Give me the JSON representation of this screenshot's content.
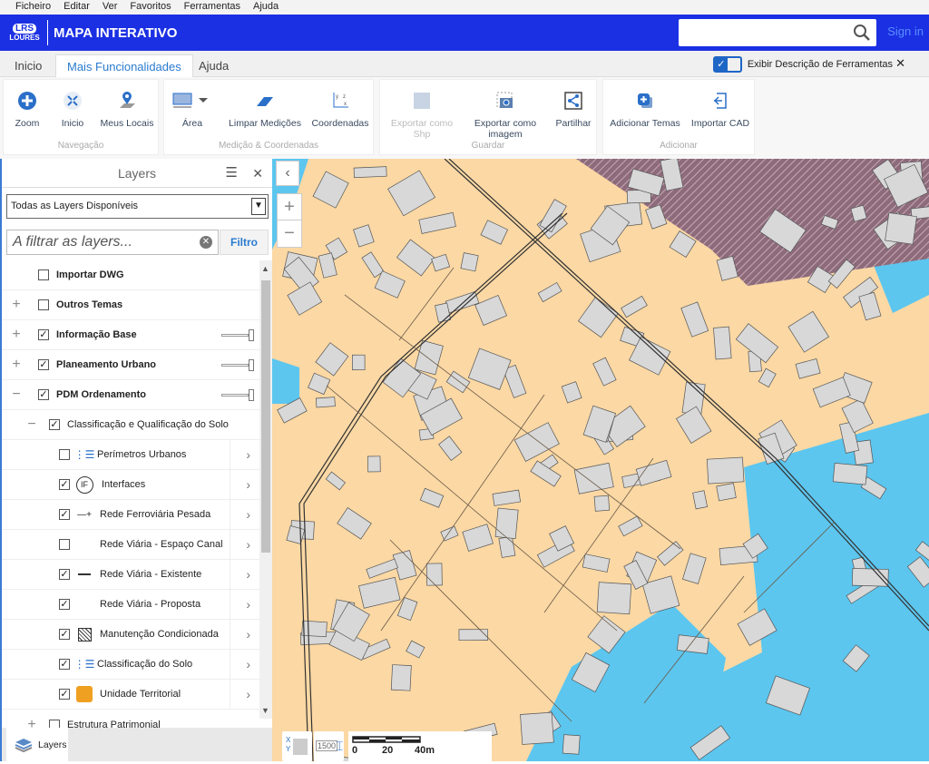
{
  "menu": [
    "Ficheiro",
    "Editar",
    "Ver",
    "Favoritos",
    "Ferramentas",
    "Ajuda"
  ],
  "header": {
    "logo_text": "LRS",
    "logo_sub": "LOURES",
    "title": "MAPA INTERATIVO",
    "search_placeholder": "",
    "signin": "Sign in"
  },
  "tabs": [
    {
      "label": "Inicio"
    },
    {
      "label": "Mais Funcionalidades",
      "active": true
    },
    {
      "label": "Ajuda"
    }
  ],
  "show_descriptions": {
    "label": "Exibir Descrição de Ferramentas",
    "checked": true,
    "close": "✕"
  },
  "ribbon": {
    "groups": [
      {
        "label": "Navegação",
        "buttons": [
          "Zoom",
          "Inicio",
          "Meus Locais"
        ]
      },
      {
        "label": "Medição & Coordenadas",
        "buttons": [
          "Área",
          "Limpar Medições",
          "Coordenadas"
        ]
      },
      {
        "label": "Guardar",
        "buttons": [
          "Exportar como Shp",
          "Exportar como imagem",
          "Partilhar"
        ]
      },
      {
        "label": "Adicionar",
        "buttons": [
          "Adicionar Temas",
          "Importar CAD"
        ]
      }
    ]
  },
  "layers_panel": {
    "title": "Layers",
    "select_value": "Todas as Layers Disponíveis",
    "filter_placeholder": "A filtrar as layers...",
    "filter_button": "Filtro",
    "items": [
      {
        "label": "Importar DWG",
        "checked": false,
        "level": 0
      },
      {
        "label": "Outros Temas",
        "checked": false,
        "level": 0,
        "expander": "+"
      },
      {
        "label": "Informação Base",
        "checked": true,
        "level": 0,
        "expander": "+"
      },
      {
        "label": "Planeamento Urbano",
        "checked": true,
        "level": 0,
        "expander": "+"
      },
      {
        "label": "PDM Ordenamento",
        "checked": true,
        "level": 0,
        "expander": "−"
      },
      {
        "label": "Classificação e Qualificação do Solo",
        "checked": true,
        "level": 1,
        "expander": "−"
      },
      {
        "label": "Perímetros Urbanos",
        "checked": false,
        "level": 2,
        "icon": "legend-list-icon"
      },
      {
        "label": "Interfaces",
        "checked": true,
        "level": 2,
        "icon": "if-circle-icon"
      },
      {
        "label": "Rede Ferroviária Pesada",
        "checked": true,
        "level": 2,
        "icon": "railway-line-icon"
      },
      {
        "label": "Rede Viária - Espaço Canal",
        "checked": false,
        "level": 2,
        "icon": ""
      },
      {
        "label": "Rede Viária - Existente",
        "checked": true,
        "level": 2,
        "icon": "road-line-icon"
      },
      {
        "label": "Rede Viária - Proposta",
        "checked": true,
        "level": 2,
        "icon": ""
      },
      {
        "label": "Manutenção Condicionada",
        "checked": true,
        "level": 2,
        "icon": "hatched-square-icon"
      },
      {
        "label": "Classificação do Solo",
        "checked": true,
        "level": 2,
        "icon": "legend-list-icon"
      },
      {
        "label": "Unidade Territorial",
        "checked": true,
        "level": 2,
        "icon": "orange-patch-icon"
      }
    ],
    "footer_item": {
      "label": "Estrutura Patrimonial",
      "checked": false,
      "expander": "+"
    },
    "bottom_tab": "Layers"
  },
  "map": {
    "zoom_in": "+",
    "zoom_out": "−",
    "collapse": "‹",
    "scale_label": "1500",
    "scale_ticks": [
      "0",
      "20",
      "40m"
    ]
  },
  "colors": {
    "header": "#1b30e3",
    "land": "#fbd8a4",
    "water": "#5cc6ef",
    "building": "#d8d8d8",
    "hatch": "#8d6b7b",
    "accent": "#2a7bd0"
  }
}
